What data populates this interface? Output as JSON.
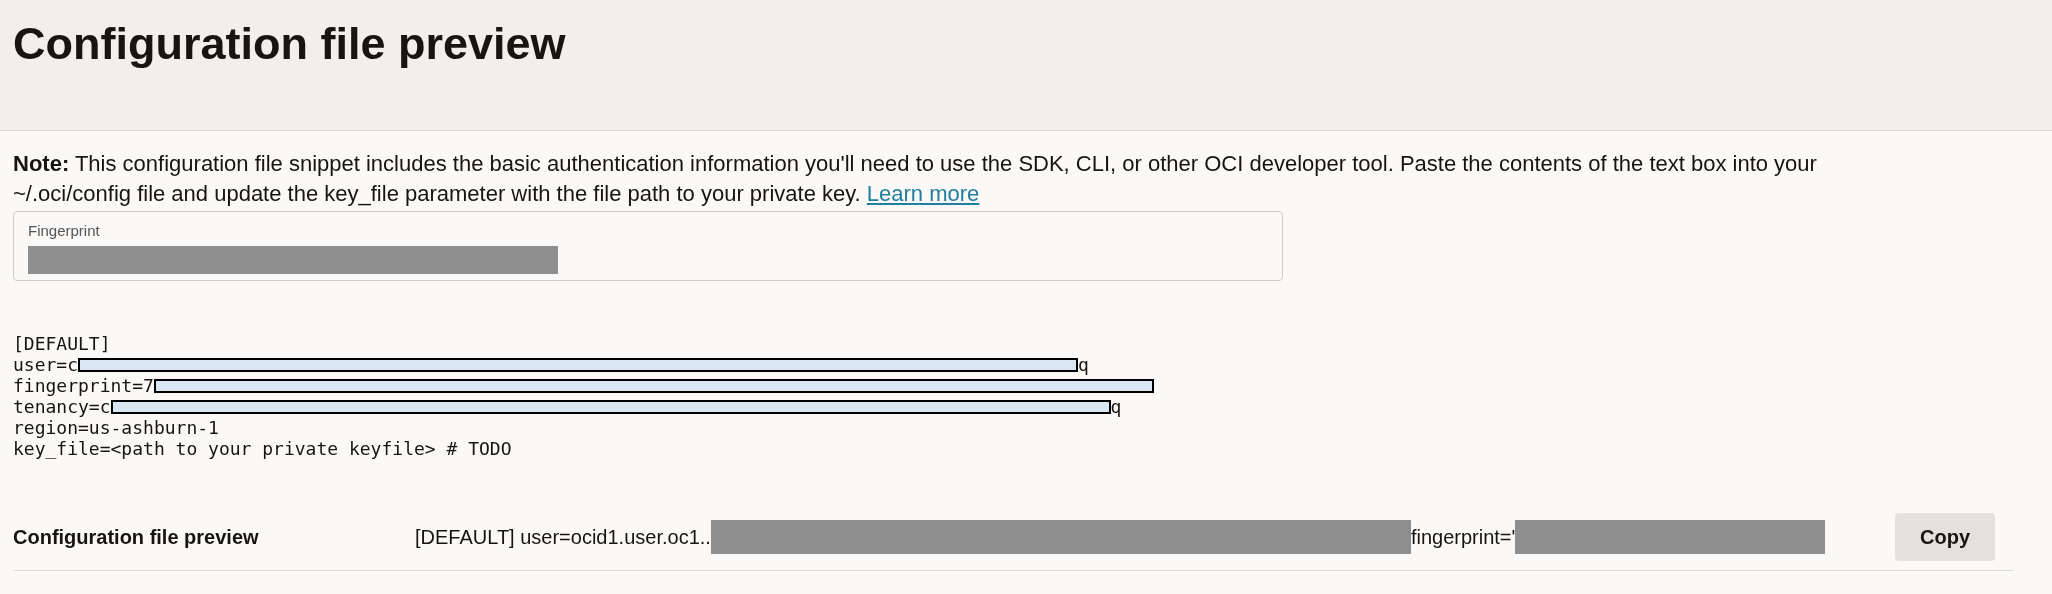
{
  "header": {
    "title": "Configuration file preview"
  },
  "note": {
    "text": "**Note:** This configuration file snippet includes the basic authentication information you'll need to use the SDK, CLI, or other OCI developer tool. Paste the contents of the text box into your ~/.oci/config file and update the key_file parameter with the file path to your private key.",
    "link": "Learn more"
  },
  "fingerprint_field": {
    "label": "Fingerprint",
    "redacted": true
  },
  "config_lines": [
    {
      "text": "[DEFAULT]",
      "redacted": false
    },
    {
      "text": "user=c",
      "redacted": true,
      "tail": "q"
    },
    {
      "text": "fingerprint=7",
      "redacted": true
    },
    {
      "text": "tenancy=c",
      "redacted": true,
      "tail": "q"
    },
    {
      "text": "region=us-ashburn-1",
      "redacted": false
    },
    {
      "text": "key_file=<path to your private keyfile> # TODO",
      "redacted": false
    }
  ],
  "preview_row": {
    "label": "Configuration file preview",
    "segments": [
      {
        "text": "[DEFAULT] user=ocid1.user.oc1..",
        "redacted": true
      },
      {
        "text": "fingerprint='",
        "redacted": true
      }
    ],
    "button": "Copy"
  }
}
